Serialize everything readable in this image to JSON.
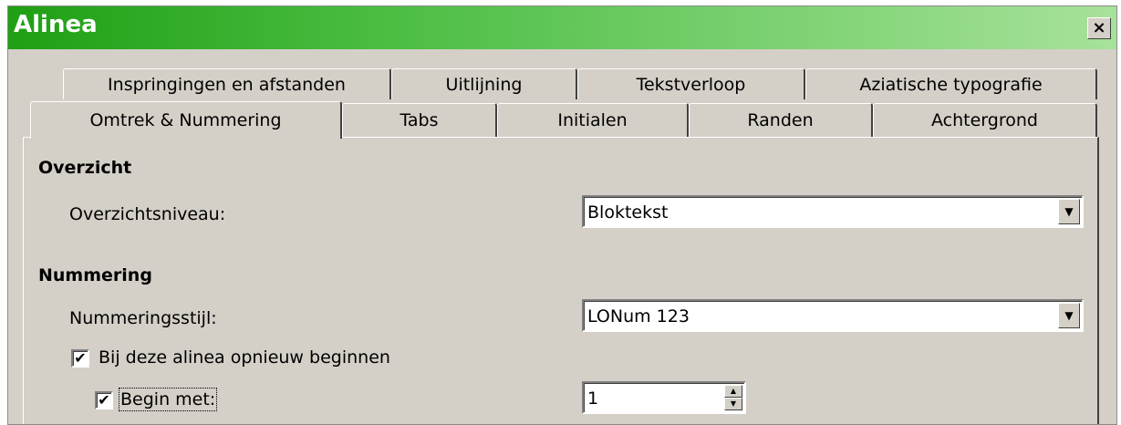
{
  "window": {
    "title": "Alinea",
    "close_glyph": "×"
  },
  "tabs": {
    "row1": [
      {
        "label": "Inspringingen en afstanden"
      },
      {
        "label": "Uitlijning"
      },
      {
        "label": "Tekstverloop"
      },
      {
        "label": "Aziatische typografie"
      }
    ],
    "row2": [
      {
        "label": "Omtrek & Nummering",
        "active": true
      },
      {
        "label": "Tabs"
      },
      {
        "label": "Initialen"
      },
      {
        "label": "Randen"
      },
      {
        "label": "Achtergrond"
      }
    ]
  },
  "outline": {
    "heading": "Overzicht",
    "level_label": "Overzichtsniveau:",
    "level_value": "Bloktekst"
  },
  "numbering": {
    "heading": "Nummering",
    "style_label": "Nummeringsstijl:",
    "style_value": "LONum 123",
    "restart_label": "Bij deze alinea opnieuw beginnen",
    "restart_checked": true,
    "start_label": "Begin met:",
    "start_checked": true,
    "start_value": "1"
  },
  "icons": {
    "dropdown": "chevron-down-icon",
    "check": "checkmark-icon",
    "spin_up": "arrow-up-icon",
    "spin_down": "arrow-down-icon"
  }
}
